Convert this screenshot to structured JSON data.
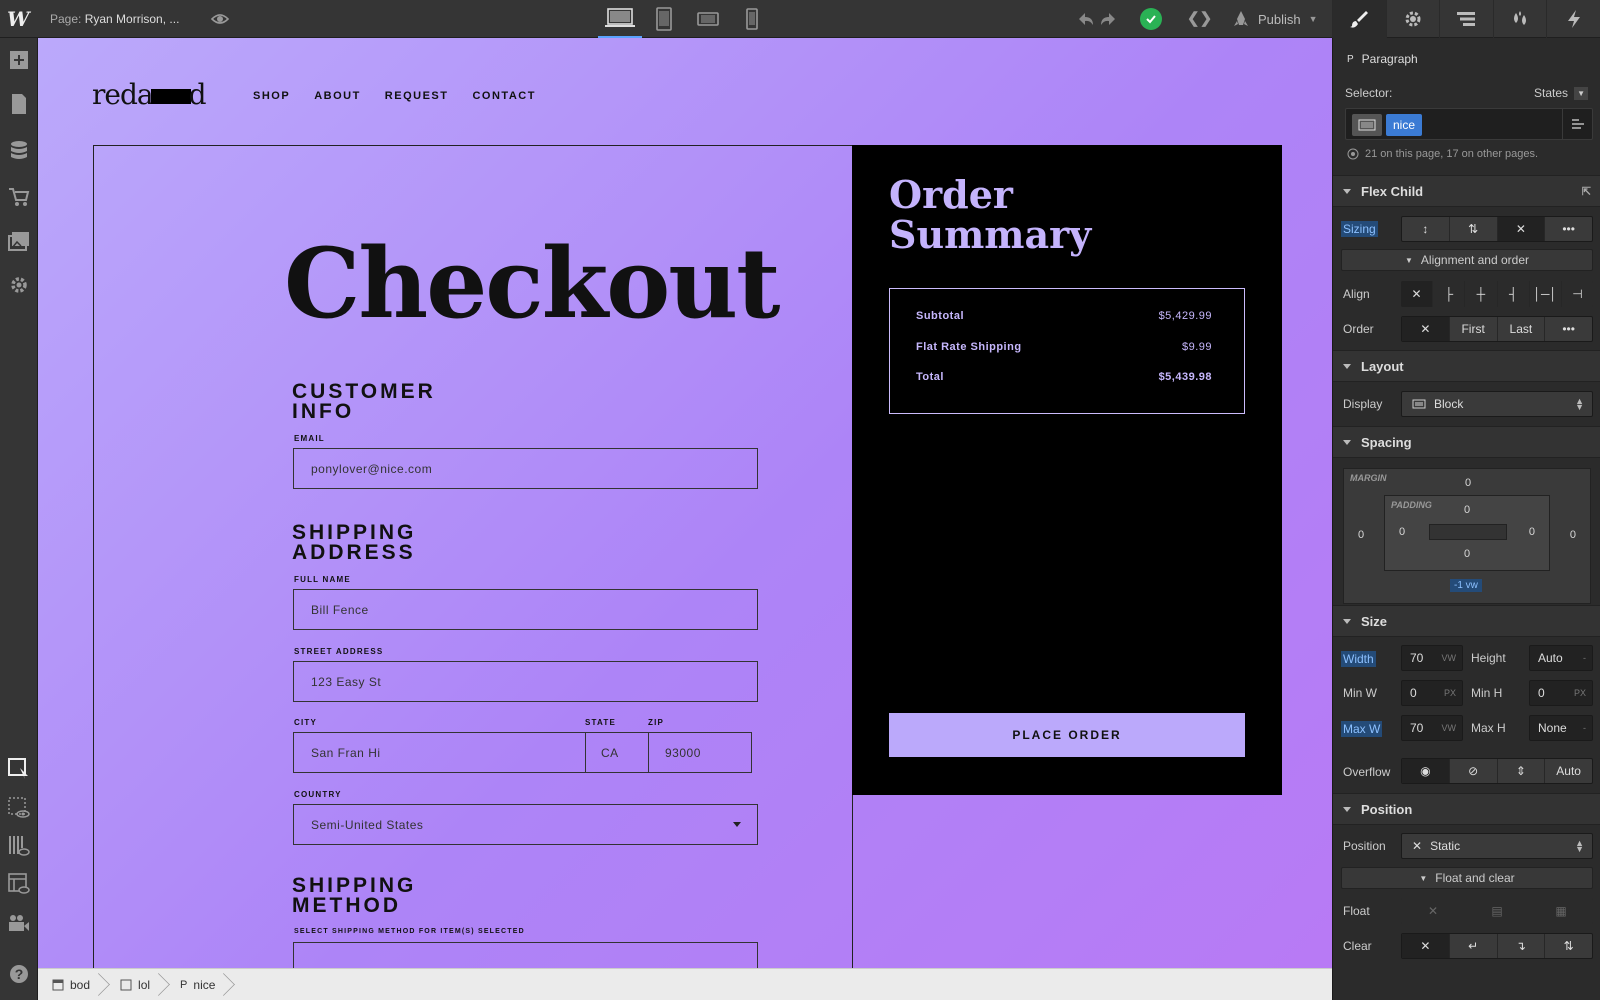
{
  "topbar": {
    "page_label": "Page:",
    "page_name": "Ryan Morrison, ...",
    "publish_label": "Publish"
  },
  "site": {
    "logo_left": "reda",
    "logo_right": "d",
    "nav": [
      "SHOP",
      "ABOUT",
      "REQUEST",
      "CONTACT"
    ],
    "checkout_title": "Checkout",
    "customer_info": {
      "title_line1": "CUSTOMER",
      "title_line2": "INFO",
      "email_label": "EMAIL",
      "email_value": "ponylover@nice.com"
    },
    "shipping_address": {
      "title_line1": "SHIPPING",
      "title_line2": "ADDRESS",
      "full_name_label": "FULL NAME",
      "full_name_value": "Bill Fence",
      "street_label": "STREET ADDRESS",
      "street_value": "123 Easy St",
      "city_label": "CITY",
      "city_value": "San Fran Hi",
      "state_label": "STATE",
      "state_value": "CA",
      "zip_label": "ZIP",
      "zip_value": "93000",
      "country_label": "COUNTRY",
      "country_value": "Semi-United States"
    },
    "shipping_method": {
      "title_line1": "SHIPPING",
      "title_line2": "METHOD",
      "subtitle": "SELECT SHIPPING METHOD FOR ITEM(S) SELECTED"
    },
    "order_summary": {
      "title_line1": "Order",
      "title_line2": "Summary",
      "rows": [
        {
          "label": "Subtotal",
          "value": "$5,429.99"
        },
        {
          "label": "Flat Rate Shipping",
          "value": "$9.99"
        },
        {
          "label": "Total",
          "value": "$5,439.98"
        }
      ],
      "place_order": "PLACE ORDER"
    }
  },
  "breadcrumb": [
    {
      "icon": "body-icon",
      "label": "bod"
    },
    {
      "icon": "div-icon",
      "label": "lol"
    },
    {
      "icon": "paragraph-icon",
      "label": "nice"
    }
  ],
  "panel": {
    "element_type": "Paragraph",
    "selector_label": "Selector:",
    "states_label": "States",
    "class_tag": "nice",
    "usage_info": "21 on this page, 17 on other pages.",
    "flex_child": {
      "title": "Flex Child",
      "sizing": "Sizing",
      "align_order_label": "Alignment and order",
      "align": "Align",
      "order": "Order",
      "first": "First",
      "last": "Last"
    },
    "layout": {
      "title": "Layout",
      "display_label": "Display",
      "display_value": "Block"
    },
    "spacing": {
      "title": "Spacing",
      "margin_label": "MARGIN",
      "padding_label": "PADDING",
      "margin_top": "0",
      "margin_left": "0",
      "margin_right": "0",
      "margin_bottom": "-1 vw",
      "padding_top": "0",
      "padding_left": "0",
      "padding_right": "0",
      "padding_bottom": "0"
    },
    "size": {
      "title": "Size",
      "width_label": "Width",
      "width_value": "70",
      "width_unit": "VW",
      "height_label": "Height",
      "height_value": "Auto",
      "height_unit": "-",
      "minw_label": "Min W",
      "minw_value": "0",
      "minw_unit": "PX",
      "minh_label": "Min H",
      "minh_value": "0",
      "minh_unit": "PX",
      "maxw_label": "Max W",
      "maxw_value": "70",
      "maxw_unit": "VW",
      "maxh_label": "Max H",
      "maxh_value": "None",
      "maxh_unit": "-",
      "overflow_label": "Overflow",
      "overflow_auto": "Auto"
    },
    "position": {
      "title": "Position",
      "position_label": "Position",
      "position_value": "Static",
      "float_clear_label": "Float and clear",
      "float_label": "Float",
      "clear_label": "Clear"
    }
  },
  "colors": {
    "accent": "#5aa2ff",
    "canvas_start": "#bba9fb",
    "canvas_end": "#b87af5",
    "published_ok": "#2ab255",
    "class_tag": "#3b7bd4"
  }
}
